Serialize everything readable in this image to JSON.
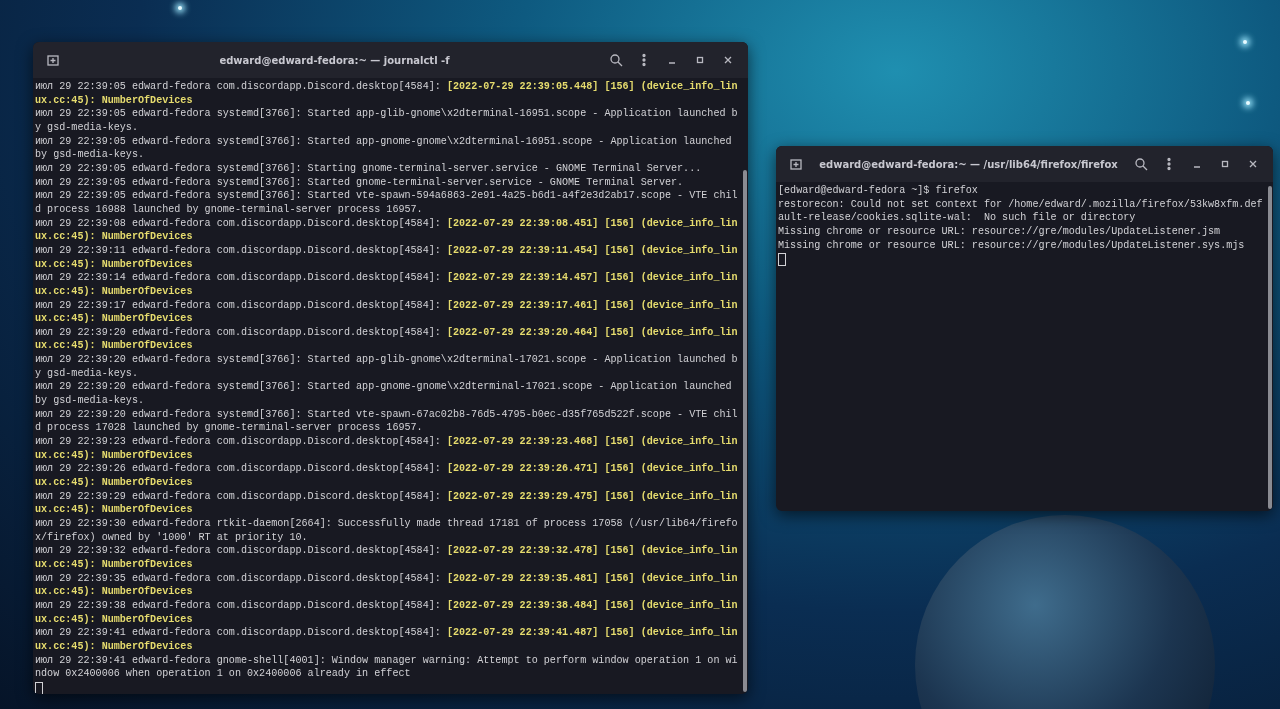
{
  "windows": [
    {
      "title": "edward@edward-fedora:~ — journalctl -f",
      "lines": [
        "июл 29 22:39:05 edward-fedora com.discordapp.Discord.desktop[4584]: **[2022-07-29 22:39:05.448] [156] (device_info_linux.cc:45): NumberOfDevices**",
        "июл 29 22:39:05 edward-fedora systemd[3766]: Started app-glib-gnome\\x2dterminal-16951.scope - Application launched by gsd-media-keys.",
        "июл 29 22:39:05 edward-fedora systemd[3766]: Started app-gnome-gnome\\x2dterminal-16951.scope - Application launched by gsd-media-keys.",
        "июл 29 22:39:05 edward-fedora systemd[3766]: Starting gnome-terminal-server.service - GNOME Terminal Server...",
        "июл 29 22:39:05 edward-fedora systemd[3766]: Started gnome-terminal-server.service - GNOME Terminal Server.",
        "июл 29 22:39:05 edward-fedora systemd[3766]: Started vte-spawn-594a6863-2e91-4a25-b6d1-a4f2e3d2ab17.scope - VTE child process 16988 launched by gnome-terminal-server process 16957.",
        "июл 29 22:39:08 edward-fedora com.discordapp.Discord.desktop[4584]: **[2022-07-29 22:39:08.451] [156] (device_info_linux.cc:45): NumberOfDevices**",
        "июл 29 22:39:11 edward-fedora com.discordapp.Discord.desktop[4584]: **[2022-07-29 22:39:11.454] [156] (device_info_linux.cc:45): NumberOfDevices**",
        "июл 29 22:39:14 edward-fedora com.discordapp.Discord.desktop[4584]: **[2022-07-29 22:39:14.457] [156] (device_info_linux.cc:45): NumberOfDevices**",
        "июл 29 22:39:17 edward-fedora com.discordapp.Discord.desktop[4584]: **[2022-07-29 22:39:17.461] [156] (device_info_linux.cc:45): NumberOfDevices**",
        "июл 29 22:39:20 edward-fedora com.discordapp.Discord.desktop[4584]: **[2022-07-29 22:39:20.464] [156] (device_info_linux.cc:45): NumberOfDevices**",
        "июл 29 22:39:20 edward-fedora systemd[3766]: Started app-glib-gnome\\x2dterminal-17021.scope - Application launched by gsd-media-keys.",
        "июл 29 22:39:20 edward-fedora systemd[3766]: Started app-gnome-gnome\\x2dterminal-17021.scope - Application launched by gsd-media-keys.",
        "июл 29 22:39:20 edward-fedora systemd[3766]: Started vte-spawn-67ac02b8-76d5-4795-b0ec-d35f765d522f.scope - VTE child process 17028 launched by gnome-terminal-server process 16957.",
        "июл 29 22:39:23 edward-fedora com.discordapp.Discord.desktop[4584]: **[2022-07-29 22:39:23.468] [156] (device_info_linux.cc:45): NumberOfDevices**",
        "июл 29 22:39:26 edward-fedora com.discordapp.Discord.desktop[4584]: **[2022-07-29 22:39:26.471] [156] (device_info_linux.cc:45): NumberOfDevices**",
        "июл 29 22:39:29 edward-fedora com.discordapp.Discord.desktop[4584]: **[2022-07-29 22:39:29.475] [156] (device_info_linux.cc:45): NumberOfDevices**",
        "июл 29 22:39:30 edward-fedora rtkit-daemon[2664]: Successfully made thread 17181 of process 17058 (/usr/lib64/firefox/firefox) owned by '1000' RT at priority 10.",
        "июл 29 22:39:32 edward-fedora com.discordapp.Discord.desktop[4584]: **[2022-07-29 22:39:32.478] [156] (device_info_linux.cc:45): NumberOfDevices**",
        "июл 29 22:39:35 edward-fedora com.discordapp.Discord.desktop[4584]: **[2022-07-29 22:39:35.481] [156] (device_info_linux.cc:45): NumberOfDevices**",
        "июл 29 22:39:38 edward-fedora com.discordapp.Discord.desktop[4584]: **[2022-07-29 22:39:38.484] [156] (device_info_linux.cc:45): NumberOfDevices**",
        "июл 29 22:39:41 edward-fedora com.discordapp.Discord.desktop[4584]: **[2022-07-29 22:39:41.487] [156] (device_info_linux.cc:45): NumberOfDevices**",
        "июл 29 22:39:41 edward-fedora gnome-shell[4001]: Window manager warning: Attempt to perform window operation 1 on window 0x2400006 when operation 1 on 0x2400006 already in effect"
      ]
    },
    {
      "title": "edward@edward-fedora:~ — /usr/lib64/firefox/firefox",
      "lines": [
        "[edward@edward-fedora ~]$ firefox",
        "restorecon: Could not set context for /home/edward/.mozilla/firefox/53kw8xfm.default-release/cookies.sqlite-wal:  No such file or directory",
        "Missing chrome or resource URL: resource://gre/modules/UpdateListener.jsm",
        "Missing chrome or resource URL: resource://gre/modules/UpdateListener.sys.mjs"
      ]
    }
  ]
}
